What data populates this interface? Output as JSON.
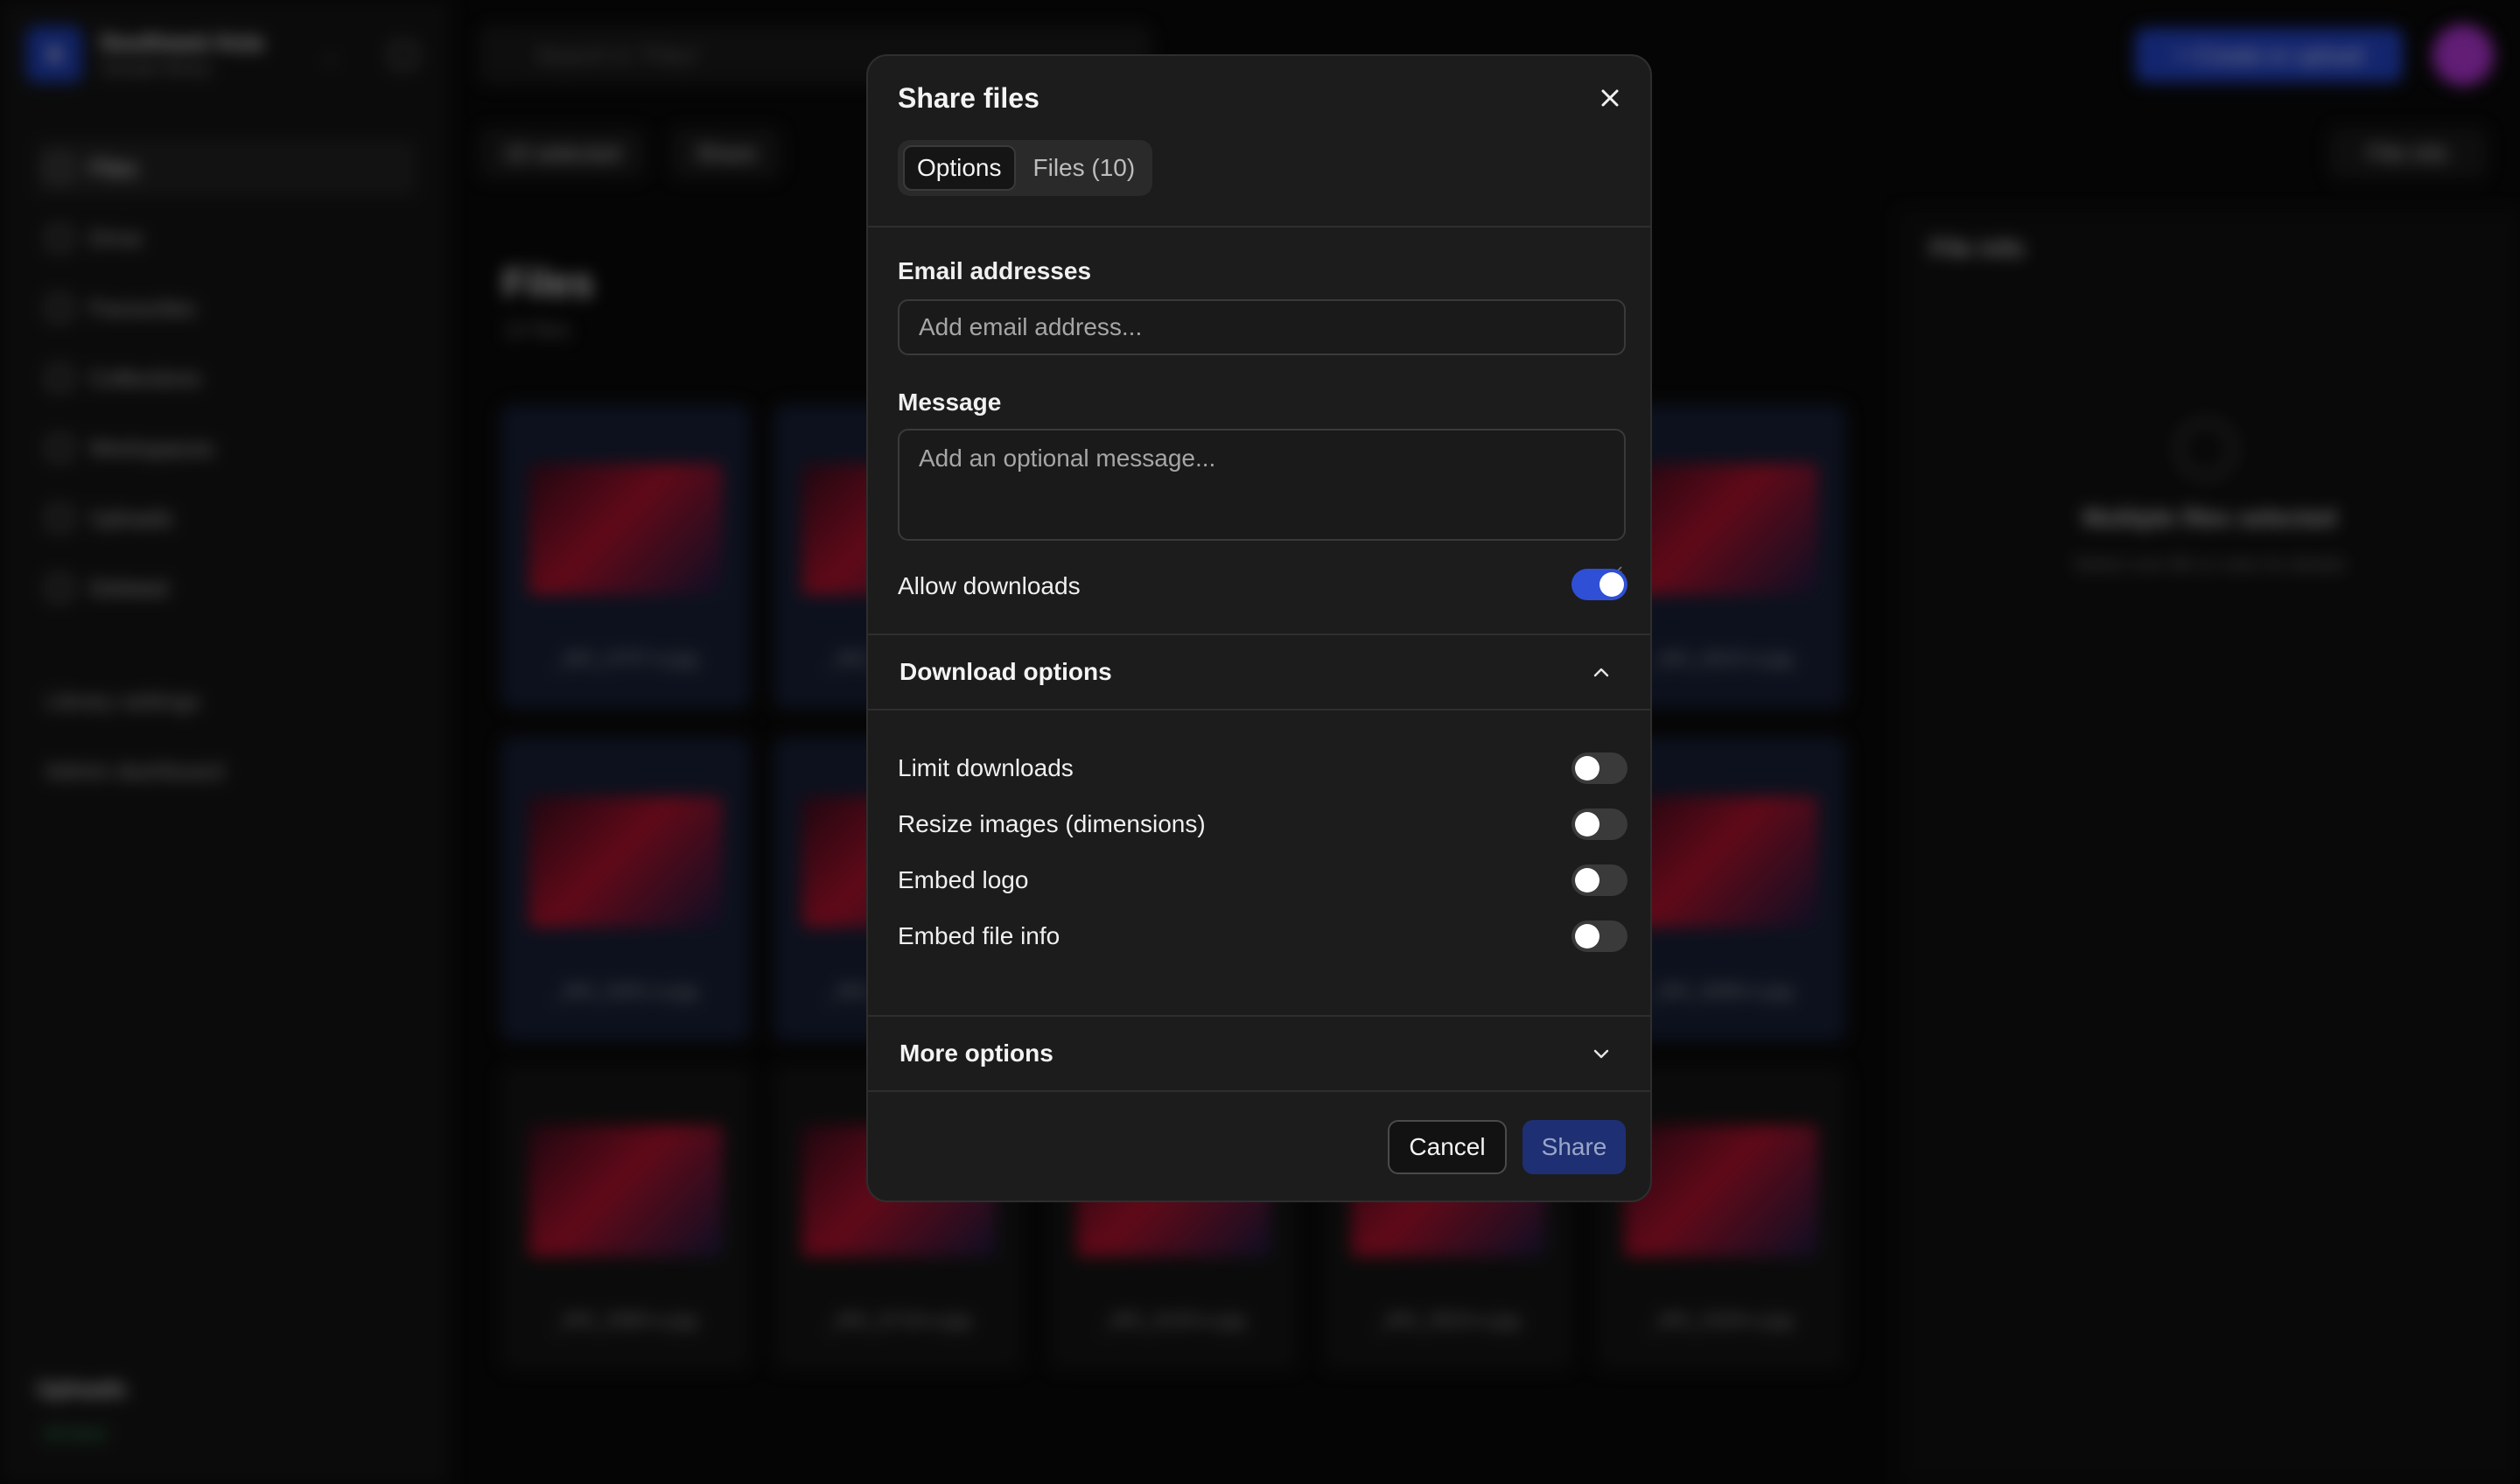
{
  "background": {
    "workspace": {
      "initial": "S",
      "name": "Southeast Asia",
      "subtitle": "Sample library"
    },
    "nav": [
      {
        "label": "Files",
        "active": true
      },
      {
        "label": "Drive",
        "active": false
      },
      {
        "label": "Favourites",
        "active": false
      },
      {
        "label": "Collections",
        "active": false
      },
      {
        "label": "Workspaces",
        "active": false
      },
      {
        "label": "Uploads",
        "active": false
      },
      {
        "label": "Deleted",
        "active": false
      }
    ],
    "side_links": [
      "Library settings",
      "Admin dashboard"
    ],
    "uploads": {
      "title": "Uploads",
      "status": "All done"
    },
    "search_placeholder": "Search in \"Files\"",
    "create_button": "+ Create or upload",
    "toolbar": {
      "selected": "10 selected",
      "share": "Share",
      "file_info": "File info"
    },
    "files": {
      "title": "Files",
      "count": "10 files"
    },
    "right_panel": {
      "title": "File info",
      "message": "Multiple files selected",
      "sub": "Select one file to view its details"
    },
    "tiles": [
      "_MG_6707-e.jpg",
      "_MG_6709-e.jpg",
      "_MG_6023-e.jpg",
      "_MG_6301-e.jpg",
      "_MG_6302-e.jpg",
      "_MG_6686-e.jpg",
      "_MG_5985-e.jpg",
      "_MG_6718-e.jpg",
      "_MG_6103-e.jpg",
      "_MG_5823-e.jpg",
      "_MG_5326-e.jpg"
    ]
  },
  "modal": {
    "title": "Share files",
    "tabs": [
      {
        "label": "Options",
        "active": true
      },
      {
        "label": "Files (10)",
        "active": false
      }
    ],
    "email": {
      "label": "Email addresses",
      "placeholder": "Add email address...",
      "value": ""
    },
    "message": {
      "label": "Message",
      "placeholder": "Add an optional message...",
      "value": ""
    },
    "allow_downloads": {
      "label": "Allow downloads",
      "on": true
    },
    "download_options": {
      "title": "Download options",
      "expanded": true,
      "items": [
        {
          "label": "Limit downloads",
          "on": false
        },
        {
          "label": "Resize images (dimensions)",
          "on": false
        },
        {
          "label": "Embed logo",
          "on": false
        },
        {
          "label": "Embed file info",
          "on": false
        }
      ]
    },
    "more_options": {
      "title": "More options",
      "expanded": false
    },
    "buttons": {
      "cancel": "Cancel",
      "share": "Share"
    }
  },
  "colors": {
    "accent": "#2f4fd6",
    "share_disabled": "#1e2f73",
    "modal_bg": "#1c1c1c"
  }
}
